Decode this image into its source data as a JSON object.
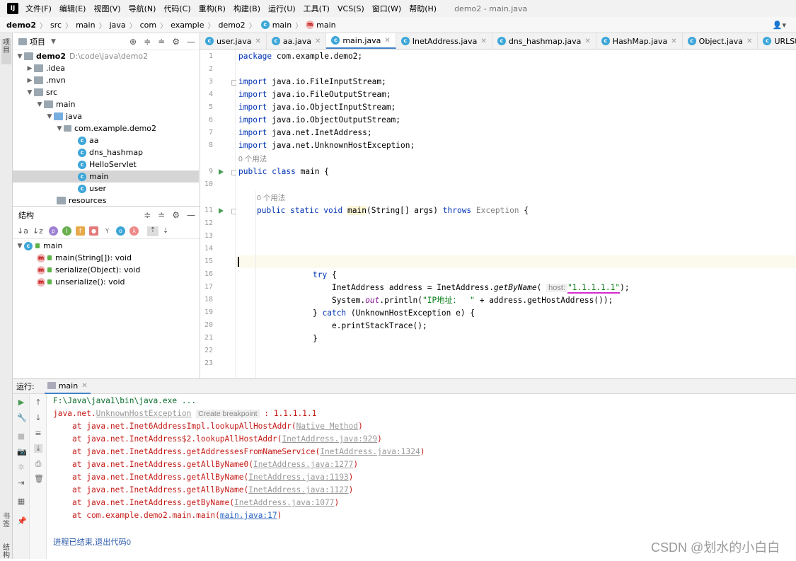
{
  "menubar": {
    "items": [
      "文件(F)",
      "编辑(E)",
      "视图(V)",
      "导航(N)",
      "代码(C)",
      "重构(R)",
      "构建(B)",
      "运行(U)",
      "工具(T)",
      "VCS(S)",
      "窗口(W)",
      "帮助(H)"
    ],
    "window_title": "demo2 - main.java"
  },
  "breadcrumb": [
    "demo2",
    "src",
    "main",
    "java",
    "com",
    "example",
    "demo2",
    "main",
    "main"
  ],
  "left_strip": {
    "project_tab": "项目",
    "bookmarks_tab": "书签",
    "structure_tab": "结构"
  },
  "project_panel": {
    "title": "项目",
    "tree": [
      {
        "label": "demo2",
        "path": "D:\\code\\java\\demo2",
        "depth": 0,
        "expanded": true,
        "kind": "module"
      },
      {
        "label": ".idea",
        "depth": 1,
        "expanded": false,
        "kind": "folder"
      },
      {
        "label": ".mvn",
        "depth": 1,
        "expanded": false,
        "kind": "folder"
      },
      {
        "label": "src",
        "depth": 1,
        "expanded": true,
        "kind": "folder"
      },
      {
        "label": "main",
        "depth": 2,
        "expanded": true,
        "kind": "folder"
      },
      {
        "label": "java",
        "depth": 3,
        "expanded": true,
        "kind": "folder-blue"
      },
      {
        "label": "com.example.demo2",
        "depth": 4,
        "expanded": true,
        "kind": "package"
      },
      {
        "label": "aa",
        "depth": 5,
        "kind": "class"
      },
      {
        "label": "dns_hashmap",
        "depth": 5,
        "kind": "class"
      },
      {
        "label": "HelloServlet",
        "depth": 5,
        "kind": "class"
      },
      {
        "label": "main",
        "depth": 5,
        "kind": "class",
        "selected": true
      },
      {
        "label": "user",
        "depth": 5,
        "kind": "class"
      },
      {
        "label": "resources",
        "depth": 3,
        "kind": "folder"
      }
    ]
  },
  "structure_panel": {
    "title": "结构",
    "root": "main",
    "members": [
      "main(String[]): void",
      "serialize(Object): void",
      "unserialize(): void"
    ]
  },
  "editor_tabs": [
    {
      "label": "user.java",
      "active": false
    },
    {
      "label": "aa.java",
      "active": false
    },
    {
      "label": "main.java",
      "active": true
    },
    {
      "label": "InetAddress.java",
      "active": false
    },
    {
      "label": "dns_hashmap.java",
      "active": false
    },
    {
      "label": "HashMap.java",
      "active": false
    },
    {
      "label": "Object.java",
      "active": false
    },
    {
      "label": "URLStreamHandler.java",
      "active": false
    }
  ],
  "editor": {
    "line_numbers": [
      "1",
      "2",
      "3",
      "4",
      "5",
      "6",
      "7",
      "8",
      "9",
      "10",
      "11",
      "12",
      "13",
      "14",
      "15",
      "16",
      "17",
      "18",
      "19",
      "20",
      "21",
      "22",
      "23"
    ],
    "package_line": "com.example.demo2;",
    "imports": [
      "java.io.FileInputStream;",
      "java.io.FileOutputStream;",
      "java.io.ObjectInputStream;",
      "java.io.ObjectOutputStream;",
      "java.net.InetAddress;",
      "java.net.UnknownHostException;"
    ],
    "usage_hint": "0 个用法",
    "class_name": "main",
    "method_sig": "(String[] args)",
    "exception": "Exception",
    "host_hint": "host:",
    "host_value": "\"1.1.1.1.1\"",
    "ip_label": "\"IP地址：  \""
  },
  "run_panel": {
    "label": "运行:",
    "tab": "main",
    "command": "F:\\Java\\java1\\bin\\java.exe ...",
    "exception_prefix": "java.net.",
    "exception_class": "UnknownHostException",
    "breakpoint_hint": "Create breakpoint",
    "exception_msg": " : 1.1.1.1.1",
    "stack": [
      {
        "method": "at java.net.Inet6AddressImpl.lookupAllHostAddr(",
        "link": "Native Method",
        "end": ")"
      },
      {
        "method": "at java.net.InetAddress$2.lookupAllHostAddr(",
        "link": "InetAddress.java:929",
        "end": ")"
      },
      {
        "method": "at java.net.InetAddress.getAddressesFromNameService(",
        "link": "InetAddress.java:1324",
        "end": ")"
      },
      {
        "method": "at java.net.InetAddress.getAllByName0(",
        "link": "InetAddress.java:1277",
        "end": ")"
      },
      {
        "method": "at java.net.InetAddress.getAllByName(",
        "link": "InetAddress.java:1193",
        "end": ")"
      },
      {
        "method": "at java.net.InetAddress.getAllByName(",
        "link": "InetAddress.java:1127",
        "end": ")"
      },
      {
        "method": "at java.net.InetAddress.getByName(",
        "link": "InetAddress.java:1077",
        "end": ")"
      },
      {
        "method": "at com.example.demo2.main.main(",
        "link": "main.java:17",
        "end": ")"
      }
    ],
    "finished": "进程已结束,退出代码0"
  },
  "watermark": "CSDN @划水的小白白"
}
